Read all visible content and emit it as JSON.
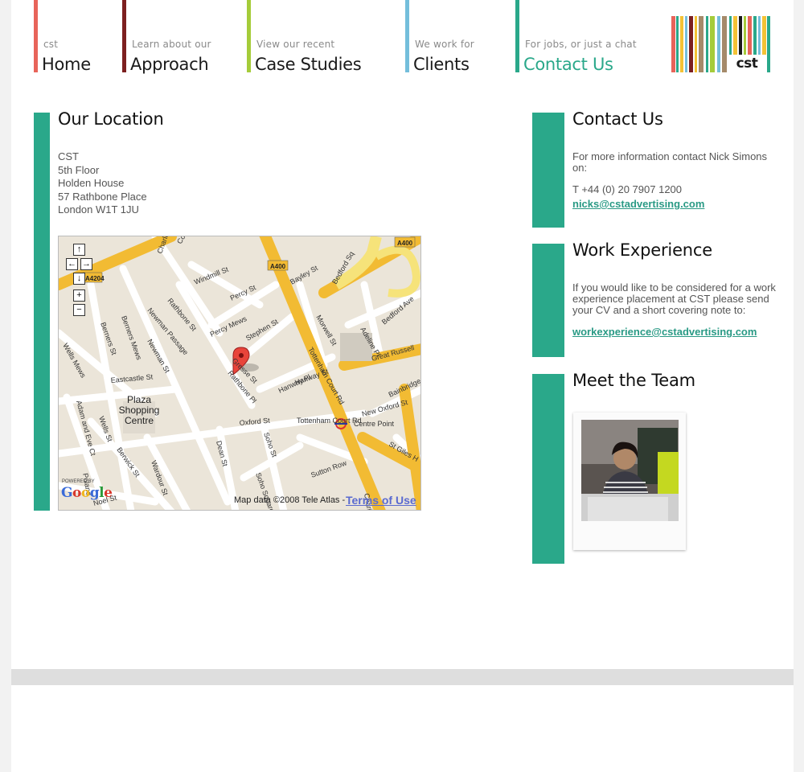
{
  "nav": [
    {
      "small": "cst",
      "big": "Home",
      "color": "#e8645a"
    },
    {
      "small": "Learn about our",
      "big": "Approach",
      "color": "#7c1f1f"
    },
    {
      "small": "View our recent",
      "big": "Case Studies",
      "color": "#a5cc3a"
    },
    {
      "small": "We work for",
      "big": "Clients",
      "color": "#74bedb"
    },
    {
      "small": "For jobs, or just a chat",
      "big": "Contact Us",
      "color": "#2aa88a",
      "active": true
    }
  ],
  "logo": {
    "text": "cst"
  },
  "location": {
    "title": "Our Location",
    "address": [
      "CST",
      "5th Floor",
      "Holden House",
      "57 Rathbone Place",
      "London W1T 1JU"
    ]
  },
  "map": {
    "controls": [
      "↑",
      "←",
      "→",
      "↓",
      "+",
      "−"
    ],
    "streets": [
      "Charlotte St",
      "Windmill St",
      "Rathbone St",
      "Percy St",
      "Tottenham Court Rd",
      "Bayley St",
      "Bedford Sq",
      "Morwell St",
      "Adeline Pl",
      "Bedford Ave",
      "Great Russell",
      "Wells Mews",
      "Berners St",
      "Berners Mews",
      "Newman Passage",
      "Newman St",
      "Percy Mews",
      "Stephen St",
      "Gresse St",
      "Rathbone Pl",
      "Hanway Pl",
      "Hanway St",
      "Eastcastle St",
      "Oxford St",
      "Adam and Eve Ct",
      "Wells St",
      "Berwick St",
      "Wardour St",
      "Dean St",
      "Soho St",
      "Soho Square",
      "Sutton Row",
      "Charing",
      "St Giles H",
      "New Oxford St",
      "Bainbridge",
      "Poland",
      "Noel St",
      "Coal",
      "Centre Point",
      "Tottenham Court Rd"
    ],
    "road_badges": [
      "A400",
      "A400",
      "A4204"
    ],
    "place": [
      "Plaza",
      "Shopping",
      "Centre"
    ],
    "powered": "POWERED BY",
    "google": "Google",
    "copyright": "Map data ©2008 Tele Atlas -",
    "terms": "Terms of Use"
  },
  "contact": {
    "title": "Contact Us",
    "text": "For more information contact Nick Simons on:",
    "phone": "T +44 (0) 20 7907 1200",
    "email": "nicks@cstadvertising.com"
  },
  "work": {
    "title": "Work Experience",
    "text": "If you would like to be considered for a work experience placement at CST please send your CV and a short covering note to:",
    "email": "workexperience@cstadvertising.com"
  },
  "team": {
    "title": "Meet the Team"
  }
}
